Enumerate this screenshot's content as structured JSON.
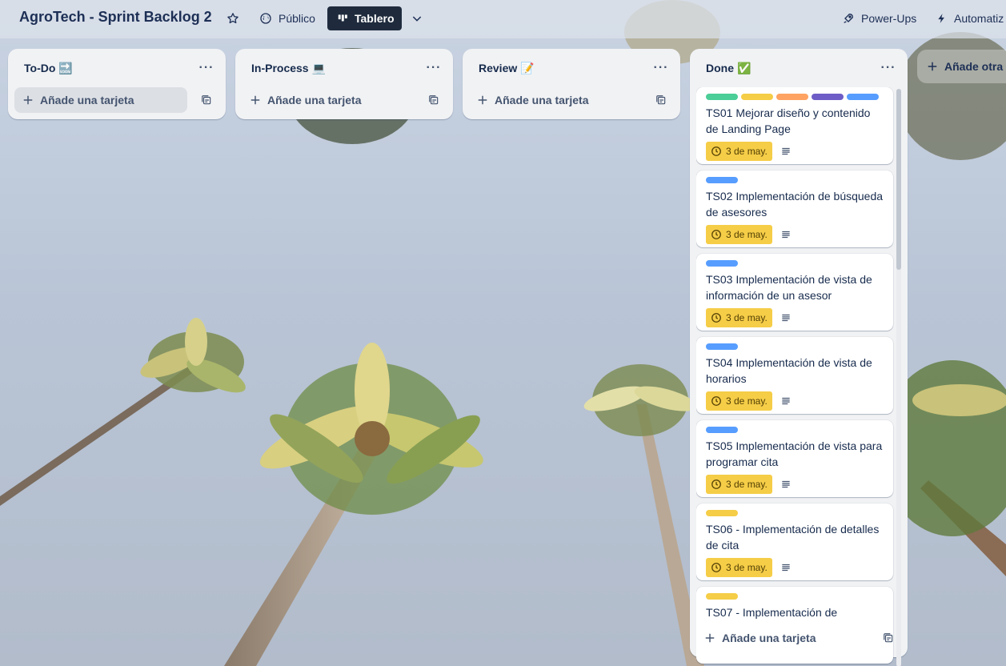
{
  "header": {
    "board_title": "AgroTech - Sprint Backlog 2",
    "visibility_label": "Público",
    "view_label": "Tablero",
    "powerups_label": "Power-Ups",
    "automation_label": "Automatiz"
  },
  "lists": [
    {
      "title": "To-Do",
      "emoji": "🔜",
      "add_card_label": "Añade una tarjeta"
    },
    {
      "title": "In-Process",
      "emoji": "💻",
      "add_card_label": "Añade una tarjeta"
    },
    {
      "title": "Review",
      "emoji": "📝",
      "add_card_label": "Añade una tarjeta"
    },
    {
      "title": "Done",
      "emoji": "✅",
      "add_card_label": "Añade una tarjeta"
    }
  ],
  "done_cards": [
    {
      "title": "TS01 Mejorar diseño y contenido de Landing Page",
      "labels": [
        "#4bce97",
        "#f5cd47",
        "#fea362",
        "#6e5dc6",
        "#579dff"
      ],
      "due": "3 de may."
    },
    {
      "title": "TS02 Implementación de búsqueda de asesores",
      "labels": [
        "#579dff"
      ],
      "due": "3 de may."
    },
    {
      "title": "TS03 Implementación de vista de información de un asesor",
      "labels": [
        "#579dff"
      ],
      "due": "3 de may."
    },
    {
      "title": "TS04 Implementación de vista de horarios",
      "labels": [
        "#579dff"
      ],
      "due": "3 de may."
    },
    {
      "title": "TS05 Implementación de vista para programar cita",
      "labels": [
        "#579dff"
      ],
      "due": "3 de may."
    },
    {
      "title": "TS06 - Implementación de detalles de cita",
      "labels": [
        "#f5cd47"
      ],
      "due": "3 de may."
    },
    {
      "title": "TS07 - Implementación de",
      "labels": [
        "#f5cd47"
      ],
      "due": ""
    }
  ],
  "add_list_label": "Añade otra lista",
  "colors": {
    "due_badge": "#f5cd47",
    "board_button": "#1f2b3d",
    "list_bg": "#f1f2f4"
  }
}
